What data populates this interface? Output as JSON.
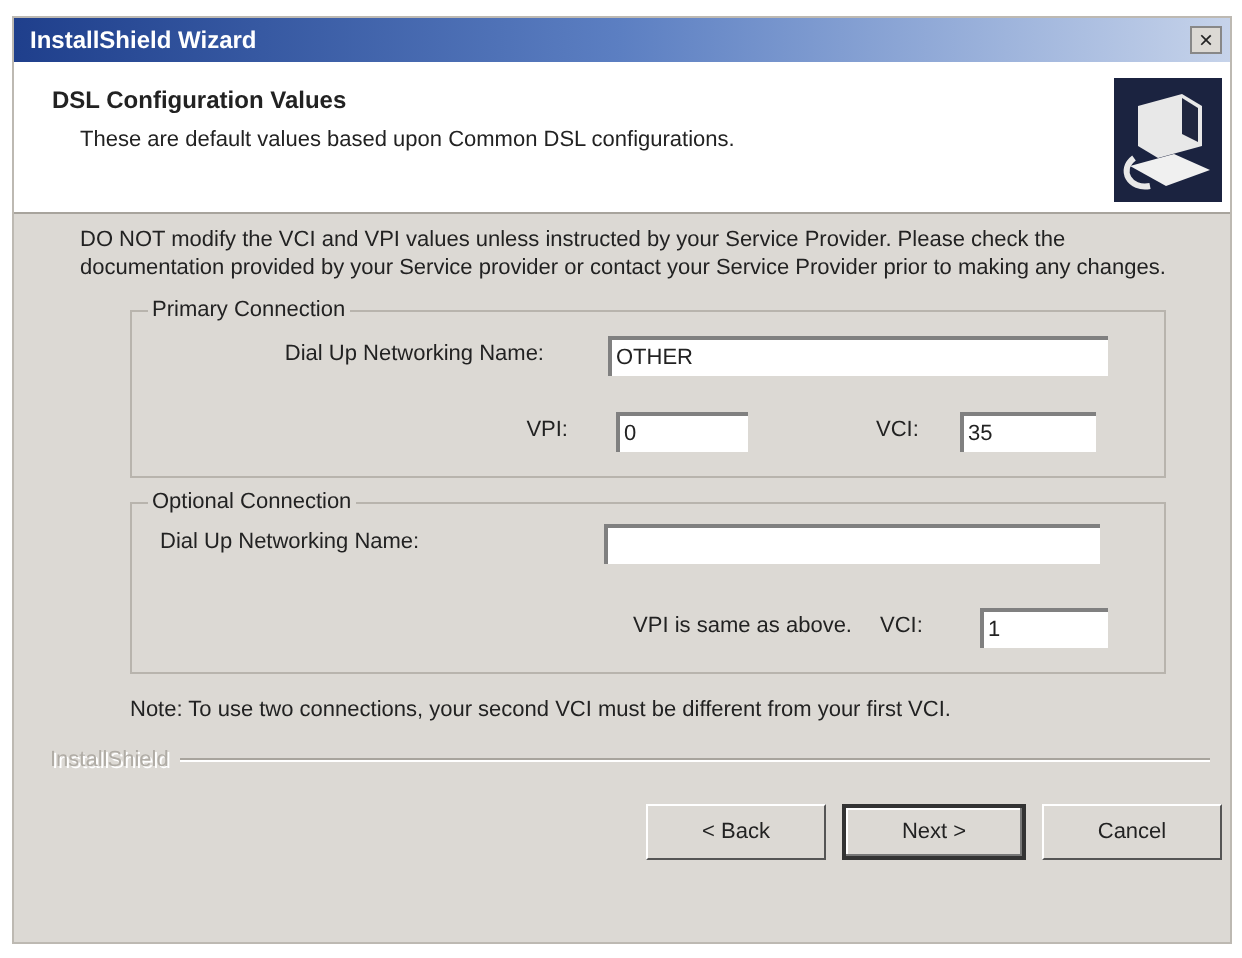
{
  "window": {
    "title": "InstallShield Wizard",
    "close": "×"
  },
  "header": {
    "title": "DSL Configuration Values",
    "subtitle": "These are default values based upon Common DSL configurations."
  },
  "instructions": "DO NOT modify the VCI and VPI values unless instructed by your Service Provider.  Please check the documentation provided by your Service provider or contact your Service Provider prior to making any changes.",
  "primary": {
    "legend": "Primary Connection",
    "name_label": "Dial Up Networking Name:",
    "name_value": "OTHER",
    "vpi_label": "VPI:",
    "vpi_value": "0",
    "vci_label": "VCI:",
    "vci_value": "35"
  },
  "optional": {
    "legend": "Optional Connection",
    "name_label": "Dial Up Networking Name:",
    "vpi_note": "VPI is same as above.",
    "vci_label": "VCI:",
    "vci_value": "1"
  },
  "note": "Note: To use two connections, your second VCI must be different from your first VCI.",
  "brand": "InstallShield",
  "buttons": [
    {
      "label": "< Back",
      "default": false
    },
    {
      "label": "Next >",
      "default": true
    },
    {
      "label": "Cancel",
      "default": false
    }
  ]
}
